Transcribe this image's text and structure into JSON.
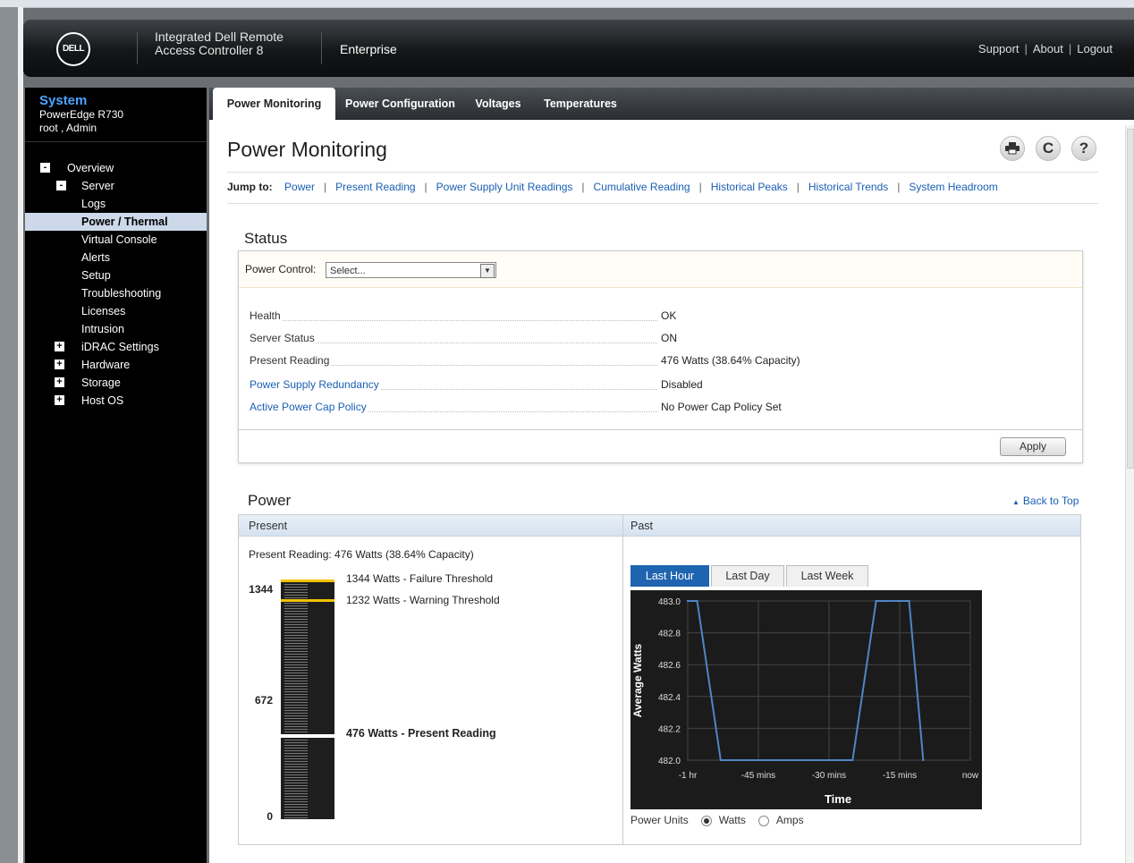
{
  "header": {
    "logo": "DELL",
    "product_line1": "Integrated Dell Remote",
    "product_line2": "Access Controller 8",
    "edition": "Enterprise",
    "links": [
      "Support",
      "About",
      "Logout"
    ]
  },
  "sidebar": {
    "system_title": "System",
    "model": "PowerEdge R730",
    "user": "root , Admin",
    "tree": [
      {
        "label": "Overview",
        "toggle": "-"
      },
      {
        "label": "Server",
        "toggle": "-"
      },
      {
        "label": "Logs"
      },
      {
        "label": "Power / Thermal",
        "selected": true
      },
      {
        "label": "Virtual Console"
      },
      {
        "label": "Alerts"
      },
      {
        "label": "Setup"
      },
      {
        "label": "Troubleshooting"
      },
      {
        "label": "Licenses"
      },
      {
        "label": "Intrusion"
      },
      {
        "label": "iDRAC Settings",
        "toggle": "+"
      },
      {
        "label": "Hardware",
        "toggle": "+"
      },
      {
        "label": "Storage",
        "toggle": "+"
      },
      {
        "label": "Host OS",
        "toggle": "+"
      }
    ]
  },
  "tabs": [
    "Power Monitoring",
    "Power Configuration",
    "Voltages",
    "Temperatures"
  ],
  "page": {
    "title": "Power Monitoring",
    "print_icon": "printer-icon",
    "refresh_icon": "refresh-icon",
    "help_icon": "help-icon",
    "help_glyph": "?",
    "refresh_glyph": "C"
  },
  "jump": {
    "label": "Jump to:",
    "links": [
      "Power",
      "Present Reading",
      "Power Supply Unit Readings",
      "Cumulative Reading",
      "Historical Peaks",
      "Historical Trends",
      "System Headroom"
    ]
  },
  "status": {
    "title": "Status",
    "power_control_label": "Power Control:",
    "power_control_value": "Select...",
    "rows": [
      {
        "label": "Health",
        "value": "OK",
        "link": false
      },
      {
        "label": "Server Status",
        "value": "ON",
        "link": false
      },
      {
        "label": "Present Reading",
        "value": "476 Watts (38.64% Capacity)",
        "link": false
      },
      {
        "label": "Power Supply Redundancy",
        "value": "Disabled",
        "link": true
      },
      {
        "label": "Active Power Cap Policy",
        "value": "No Power Cap Policy Set",
        "link": true
      }
    ],
    "apply_label": "Apply"
  },
  "power": {
    "title": "Power",
    "back_to_top": "Back to Top",
    "present_header": "Present",
    "past_header": "Past",
    "present_reading": "Present Reading: 476 Watts (38.64% Capacity)",
    "gauge": {
      "max": 1344,
      "mid": 672,
      "min": 0,
      "max_label": "1344",
      "mid_label": "672",
      "min_label": "0",
      "failure_threshold": 1344,
      "warning_threshold": 1232,
      "present": 476,
      "failure_label": "1344 Watts - Failure Threshold",
      "warning_label": "1232 Watts - Warning Threshold",
      "present_label": "476 Watts - Present Reading",
      "threshold_color": "#f2c200",
      "present_color": "#ffffff"
    },
    "chart_tabs": [
      "Last Hour",
      "Last Day",
      "Last Week"
    ],
    "units_label": "Power Units",
    "units_options": [
      "Watts",
      "Amps"
    ]
  },
  "chart_data": {
    "type": "line",
    "title": "",
    "xlabel": "Time",
    "ylabel": "Average Watts",
    "x_ticks": [
      "-1 hr",
      "-45 mins",
      "-30 mins",
      "-15 mins",
      "now"
    ],
    "y_ticks": [
      "483.0",
      "482.8",
      "482.6",
      "482.4",
      "482.2",
      "482.0"
    ],
    "ylim": [
      482.0,
      483.0
    ],
    "x": [
      "-1 hr",
      "-58 mins",
      "-53 mins",
      "-25 mins",
      "-20 mins",
      "-18 mins",
      "-13 mins",
      "-10 mins"
    ],
    "series": [
      {
        "values": [
          483.0,
          483.0,
          482.0,
          482.0,
          483.0,
          483.0,
          483.0,
          482.0
        ]
      }
    ],
    "grid": true,
    "line_color": "#4f86c6",
    "background": "#1b1b1b"
  }
}
